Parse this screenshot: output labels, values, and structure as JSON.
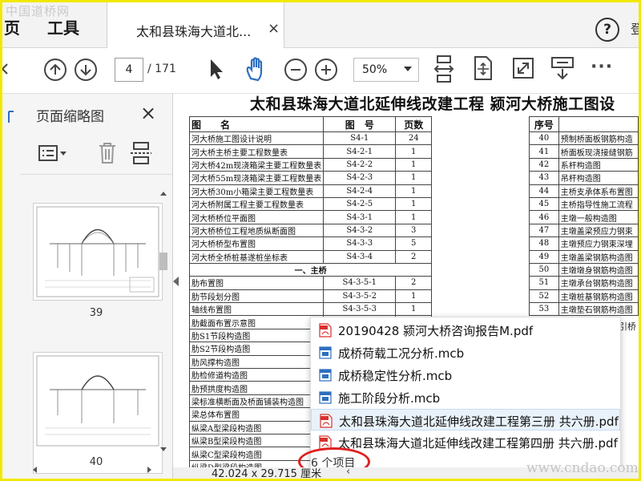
{
  "watermark": {
    "site_cn": "中国道桥网",
    "site_url": "www.cndao.com"
  },
  "menu": {
    "page": "页",
    "tools": "工具"
  },
  "tab": {
    "title": "太和县珠海大道北...",
    "close_glyph": "×"
  },
  "help": {
    "glyph": "?"
  },
  "tabbar_edge_glyph": "登",
  "toolbar": {
    "current_page": "4",
    "total_pages": "/ 171",
    "zoom": "50%",
    "more": "···"
  },
  "sidebar": {
    "title": "页面缩略图",
    "close_glyph": "×",
    "thumbnails": [
      {
        "label": "39"
      },
      {
        "label": "40"
      }
    ]
  },
  "document": {
    "title": "太和县珠海大道北延伸线改建工程 颍河大桥施工图设",
    "table_left": {
      "headers": [
        "图　　名",
        "图　号",
        "页数"
      ],
      "rows": [
        [
          "河大桥施工图设计说明",
          "S4-1",
          "24"
        ],
        [
          "河大桥主桥主要工程数量表",
          "S4-2-1",
          "1"
        ],
        [
          "河大桥42m现浇箱梁主要工程数量表",
          "S4-2-2",
          "1"
        ],
        [
          "河大桥55m现浇箱梁主要工程数量表",
          "S4-2-3",
          "1"
        ],
        [
          "河大桥30m小箱梁主要工程数量表",
          "S4-2-4",
          "1"
        ],
        [
          "河大桥附属工程主要工程数量表",
          "S4-2-5",
          "1"
        ],
        [
          "河大桥桥位平面图",
          "S4-3-1",
          "1"
        ],
        [
          "河大桥桥位工程地质纵断面图",
          "S4-3-2",
          "3"
        ],
        [
          "河大桥桥型布置图",
          "S4-3-3",
          "5"
        ],
        [
          "河大桥全桥桩基遂桩坐标表",
          "S4-3-4",
          "2"
        ]
      ],
      "section_label": "一、主桥",
      "rows2": [
        [
          "肋布置图",
          "S4-3-5-1",
          "2"
        ],
        [
          "肋节段划分图",
          "S4-3-5-2",
          "1"
        ],
        [
          "轴线布置图",
          "S4-3-5-3",
          "1"
        ],
        [
          "肋截面布置示意图",
          "",
          ""
        ],
        [
          "肋S1节段构造图",
          "",
          ""
        ],
        [
          "肋S2节段构造图",
          "",
          ""
        ],
        [
          "肋风撑构造图",
          "",
          ""
        ],
        [
          "肋检修道构造图",
          "",
          ""
        ],
        [
          "肋预拱度构造图",
          "",
          ""
        ],
        [
          "梁标准横断面及桥面铺装构造图",
          "",
          ""
        ],
        [
          "梁总体布置图",
          "",
          ""
        ],
        [
          "纵梁A型梁段构造图",
          "",
          ""
        ],
        [
          "纵梁B型梁段构造图",
          "",
          ""
        ],
        [
          "纵梁C型梁段构造图",
          "",
          ""
        ],
        [
          "纵梁D型梁段构造图",
          "",
          ""
        ]
      ]
    },
    "table_right": {
      "header": "序号",
      "rows": [
        [
          "40",
          "预制桥面板钢筋构造"
        ],
        [
          "41",
          "桥面板现浇接缝钢筋"
        ],
        [
          "42",
          "系杆构造图"
        ],
        [
          "43",
          "吊杆构造图"
        ],
        [
          "44",
          "主桥支承体系布置图"
        ],
        [
          "45",
          "主桥指导性施工流程"
        ],
        [
          "46",
          "主墩一般构造图"
        ],
        [
          "47",
          "主墩盖梁预应力钢束"
        ],
        [
          "48",
          "主墩预应力钢束深埋"
        ],
        [
          "49",
          "主墩盖梁钢筋构造图"
        ],
        [
          "50",
          "主墩墩身钢筋构造图"
        ],
        [
          "51",
          "主墩承台钢筋构造图"
        ],
        [
          "52",
          "主墩桩基钢筋构造图"
        ],
        [
          "53",
          "主墩垫石钢筋构造图"
        ]
      ]
    },
    "extra_text": "引桥"
  },
  "popup": {
    "items": [
      {
        "icon": "pdf-icon",
        "label": "20190428 颍河大桥咨询报告M.pdf"
      },
      {
        "icon": "mcb-file-icon",
        "label": "成桥荷载工况分析.mcb"
      },
      {
        "icon": "mcb-file-icon",
        "label": "成桥稳定性分析.mcb"
      },
      {
        "icon": "mcb-file-icon",
        "label": "施工阶段分析.mcb"
      },
      {
        "icon": "pdf-icon",
        "label": "太和县珠海大道北延伸线改建工程第三册 共六册.pdf"
      },
      {
        "icon": "pdf-icon",
        "label": "太和县珠海大道北延伸线改建工程第四册 共六册.pdf"
      }
    ],
    "selected_index": 4,
    "count_label": "6 个项目"
  },
  "status": {
    "dimensions": "42.024 x 29.715 厘米",
    "arrow": "‹"
  },
  "colors": {
    "highlight_border": "#f2e800",
    "annotation_ellipse": "#e02020",
    "pdf_red": "#d9302c",
    "mcb_blue": "#2d6fc0"
  }
}
